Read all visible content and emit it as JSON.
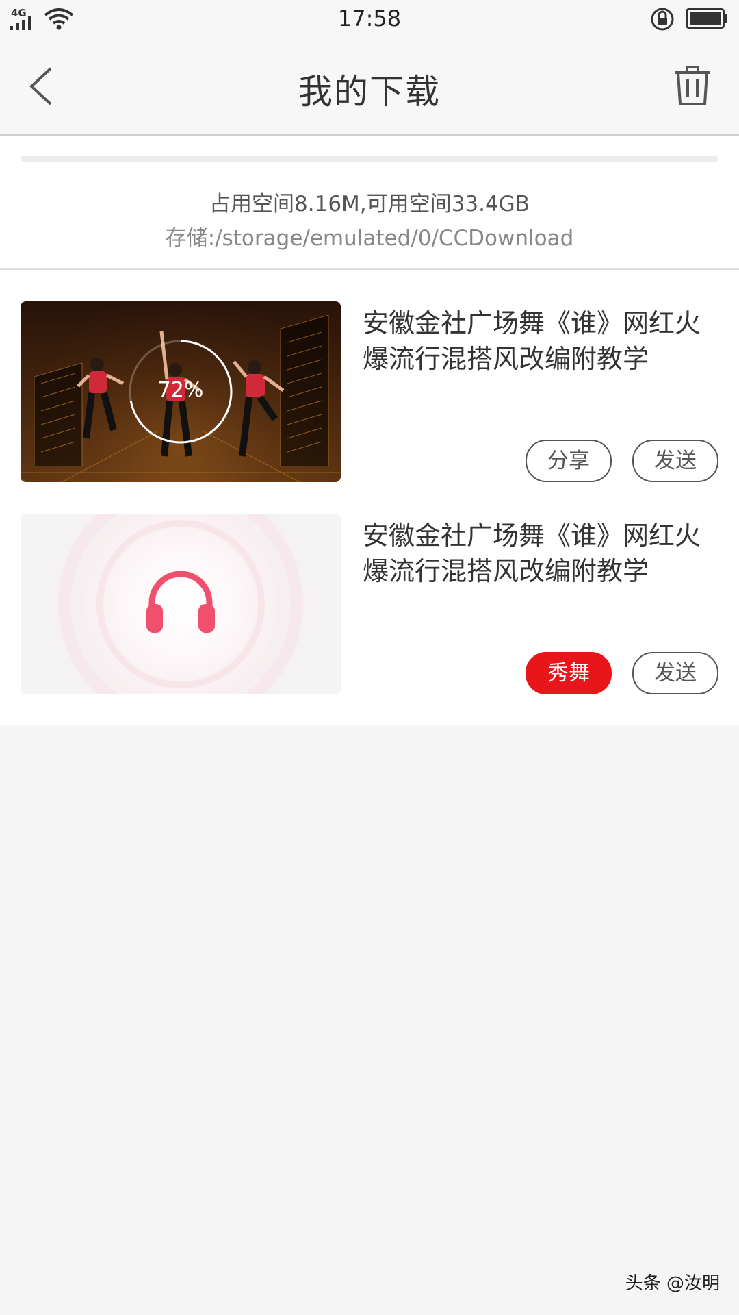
{
  "status_bar": {
    "network": "4G",
    "time": "17:58"
  },
  "header": {
    "title": "我的下载"
  },
  "storage": {
    "usage_text": "占用空间8.16M,可用空间33.4GB",
    "path_text": "存储:/storage/emulated/0/CCDownload"
  },
  "downloads": [
    {
      "title": "安徽金社广场舞《谁》网红火爆流行混搭风改编附教学",
      "progress_label": "72%",
      "progress_fraction": 0.72,
      "thumbnail_type": "video",
      "buttons": [
        "分享",
        "发送"
      ]
    },
    {
      "title": "安徽金社广场舞《谁》网红火爆流行混搭风改编附教学",
      "thumbnail_type": "audio",
      "buttons": [
        "秀舞",
        "发送"
      ]
    }
  ],
  "colors": {
    "accent_red": "#e8161b",
    "headphone_pink": "#f0506e"
  },
  "watermark": "头条 @汝明"
}
